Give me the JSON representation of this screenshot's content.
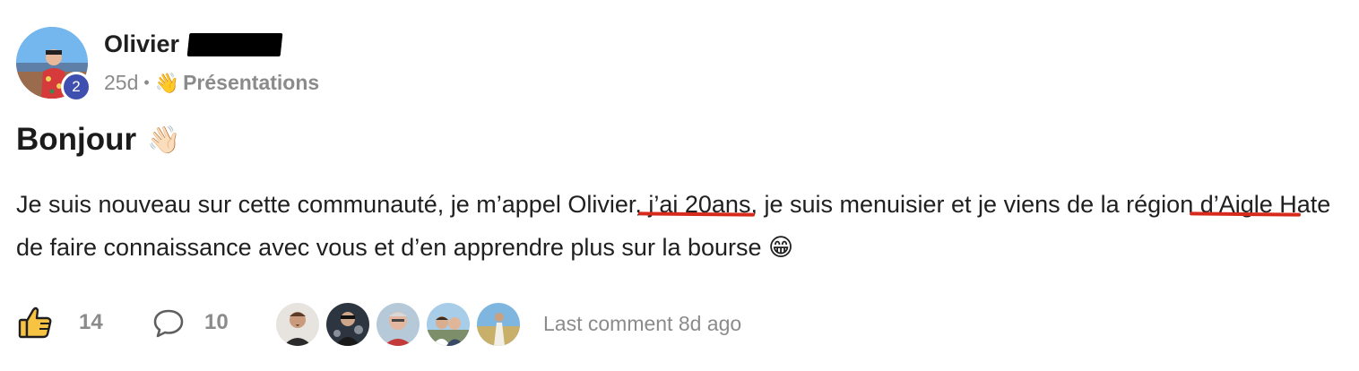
{
  "author": {
    "name": "Olivier",
    "level": "2"
  },
  "meta": {
    "age": "25d",
    "separator": "•",
    "category_emoji": "👋",
    "category": "Présentations"
  },
  "post": {
    "title": "Bonjour",
    "title_emoji": "👋🏻",
    "body_part1": "Je suis nouveau sur cette communauté, je m’appel Olivier,",
    "body_highlight1": " j’ai 20ans",
    "body_part2": ", je suis menuisier et je viens de la région",
    "body_highlight2": " d’Aigle H",
    "body_part3": "ate de faire connaissance avec vous et d’en apprendre plus sur la bourse ",
    "body_emoji": "😁",
    "annotation_color": "#d7291c"
  },
  "footer": {
    "likes": "14",
    "comments": "10",
    "last_comment": "Last comment 8d ago",
    "commenter_count": 5
  },
  "icons": {
    "like": "thumbs-up-icon",
    "comment": "comment-bubble-icon"
  },
  "colors": {
    "badge": "#3f4fb0",
    "muted": "#8b8b8b",
    "like_fill": "#f6c343"
  }
}
